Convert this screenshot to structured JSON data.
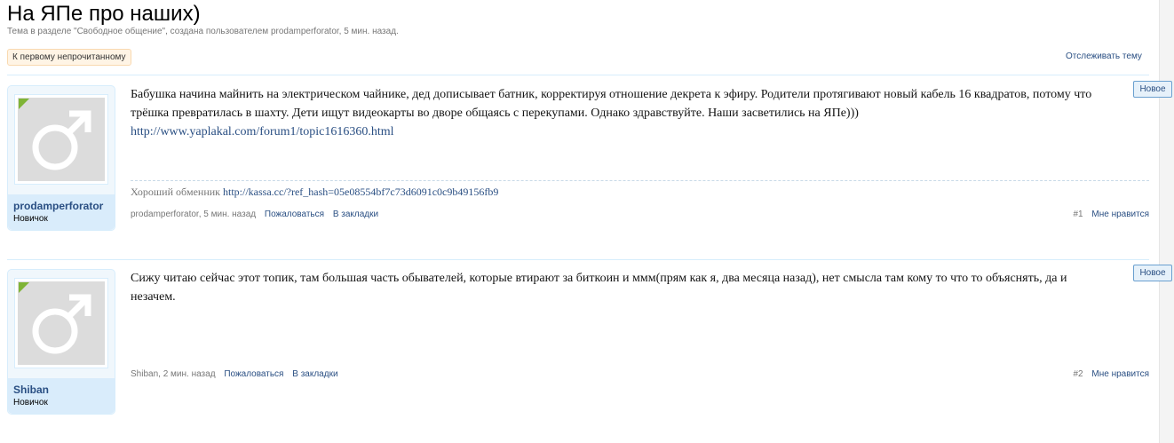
{
  "thread": {
    "title": "На ЯПе про наших)",
    "subtitle": "Тема в разделе \"Свободное общение\", создана пользователем prodamperforator, 5 мин. назад.",
    "first_unread_label": "К первому непрочитанному",
    "watch_label": "Отслеживать тему"
  },
  "posts": [
    {
      "username": "prodamperforator",
      "user_title": "Новичок",
      "body": "Бабушка начина майнить на электрическом чайнике, дед дописывает батник, корректируя отношение декрета к эфиру. Родители протягивают новый кабель 16 квадратов, потому что трёшка превратилась в шахту. Дети ищут видеокарты во дворе общаясь с перекупами. Однако здравствуйте. Наши засветились на ЯПе)))",
      "link": "http://www.yaplakal.com/forum1/topic1616360.html",
      "signature_text": "Хороший обменник",
      "signature_link": "http://kassa.cc/?ref_hash=05e08554bf7c73d6091c0c9b49156fb9",
      "meta": "prodamperforator, 5 мин. назад",
      "report_label": "Пожаловаться",
      "bookmark_label": "В закладки",
      "number": "#1",
      "like_label": "Мне нравится",
      "badge": "Новое"
    },
    {
      "username": "Shiban",
      "user_title": "Новичок",
      "body": "Сижу читаю сейчас этот топик, там большая часть обывателей, которые втирают за биткоин и ммм(прям как я, два месяца назад), нет смысла там кому то что то объяснять, да и незачем.",
      "meta": "Shiban, 2 мин. назад",
      "report_label": "Пожаловаться",
      "bookmark_label": "В закладки",
      "number": "#2",
      "like_label": "Мне нравится",
      "badge": "Новое"
    }
  ],
  "colors": {
    "link": "#2a4f83",
    "panel": "#f0f7fc",
    "panel_border": "#d7edfc",
    "online": "#7fb436"
  },
  "icons": {
    "avatar": "male-symbol-icon",
    "online": "online-indicator-icon"
  }
}
